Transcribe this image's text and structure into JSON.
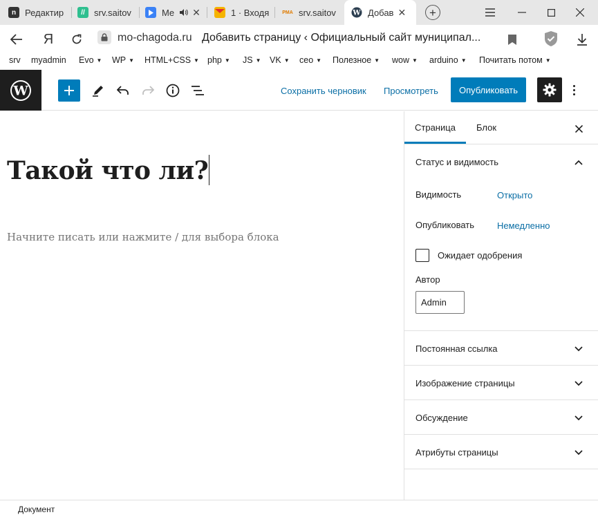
{
  "browser": {
    "tabs": [
      {
        "label": "Редактир",
        "favicon": "n",
        "favicon_color": "#333333"
      },
      {
        "label": "srv.saitov",
        "favicon": "//",
        "favicon_color": "#2fbf8f"
      },
      {
        "label": "Me",
        "favicon": "play",
        "favicon_color": "#3b82f6"
      },
      {
        "label": "1 · Входя",
        "favicon": "mail",
        "favicon_color": "#f5b400"
      },
      {
        "label": "srv.saitov",
        "favicon": "PMA",
        "favicon_color": "#e07b00"
      },
      {
        "label": "Добав",
        "favicon": "wordpress",
        "favicon_color": "#333333"
      }
    ],
    "address": {
      "host": "mo-chagoda.ru",
      "page_title": "Добавить страницу ‹ Официальный сайт муниципал..."
    },
    "bookmarks": [
      {
        "label": "srv",
        "dropdown": false
      },
      {
        "label": "myadmin",
        "dropdown": false
      },
      {
        "label": "Evo",
        "dropdown": true
      },
      {
        "label": "WP",
        "dropdown": true
      },
      {
        "label": "HTML+CSS",
        "dropdown": true
      },
      {
        "label": "php",
        "dropdown": true
      },
      {
        "label": "JS",
        "dropdown": true
      },
      {
        "label": "VK",
        "dropdown": true
      },
      {
        "label": "ceo",
        "dropdown": true
      },
      {
        "label": "Полезное",
        "dropdown": true
      },
      {
        "label": "wow",
        "dropdown": true
      },
      {
        "label": "arduino",
        "dropdown": true
      },
      {
        "label": "Почитать потом",
        "dropdown": true
      }
    ],
    "caret_symbol": "▼"
  },
  "toolbar": {
    "save_draft": "Сохранить черновик",
    "preview": "Просмотреть",
    "publish": "Опубликовать",
    "accent": "#007cba"
  },
  "editor": {
    "title": "Такой что ли?",
    "placeholder": "Начните писать или нажмите / для выбора блока"
  },
  "sidebar": {
    "tabs": [
      "Страница",
      "Блок"
    ],
    "active_tab": "Страница",
    "status_panel": {
      "heading": "Статус и видимость",
      "visibility_label": "Видимость",
      "visibility_value": "Открыто",
      "publish_label": "Опубликовать",
      "publish_value": "Немедленно",
      "pending_label": "Ожидает одобрения",
      "author_label": "Автор",
      "author_value": "Admin"
    },
    "panels": [
      "Постоянная ссылка",
      "Изображение страницы",
      "Обсуждение",
      "Атрибуты страницы"
    ]
  },
  "footer": {
    "breadcrumb": "Документ"
  }
}
